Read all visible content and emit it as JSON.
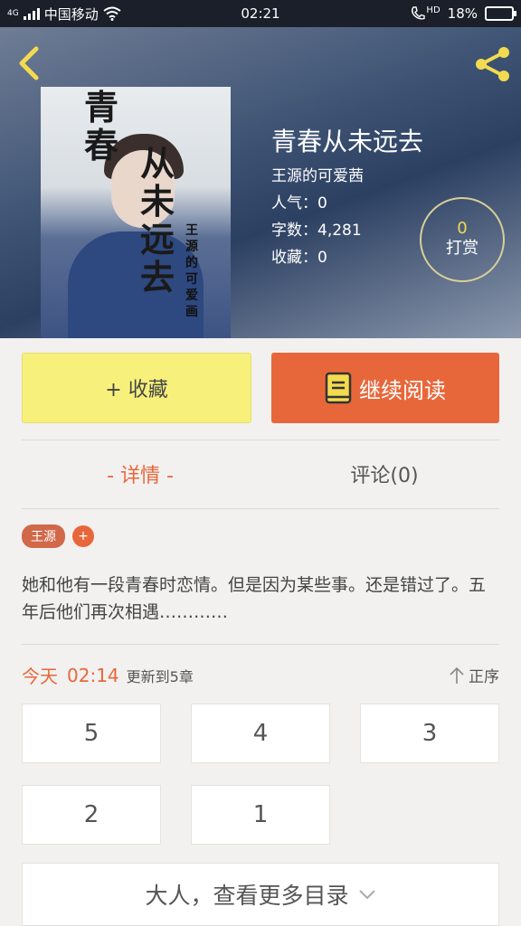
{
  "status_bar": {
    "network": "4G",
    "carrier": "中国移动",
    "time": "02:21",
    "hd": "HD",
    "battery": "18%",
    "battery_level": 0.18
  },
  "book": {
    "cover_title_line1": "青春",
    "cover_title_line2": "从未远去",
    "cover_author": "王源的可爱画",
    "title": "青春从未远去",
    "author": "王源的可爱茜",
    "popularity": "人气：0",
    "word_count": "字数：4,281",
    "favorites": "收藏：0"
  },
  "tip": {
    "count": "0",
    "label": "打赏"
  },
  "actions": {
    "collect_label": "+ 收藏",
    "read_label": "继续阅读"
  },
  "tabs": {
    "details": "- 详情 -",
    "comments": "评论(0)"
  },
  "tags": {
    "tag1": "王源",
    "add": "+"
  },
  "synopsis": "她和他有一段青春时恋情。但是因为某些事。还是错过了。五年后他们再次相遇…………",
  "update": {
    "day": "今天",
    "time": "02:14",
    "text": "更新到5章",
    "sort_label": "正序"
  },
  "chapters": [
    "5",
    "4",
    "3",
    "2",
    "1"
  ],
  "more_label": "大人，查看更多目录",
  "colors": {
    "accent": "#e8673a",
    "collect_bg": "#f7f17c",
    "tip_number": "#f3da4f"
  }
}
